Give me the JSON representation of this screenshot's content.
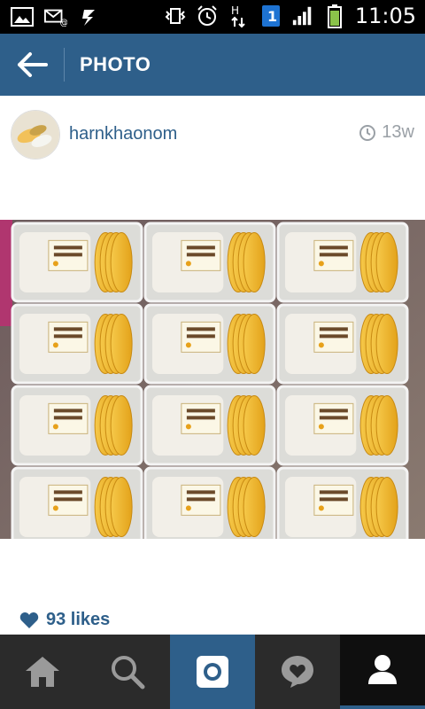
{
  "status_bar": {
    "time": "11:05",
    "notification_icons": [
      "gallery-icon",
      "messaging-icon",
      "usb-icon"
    ],
    "system_icons": [
      "vibrate-icon",
      "alarm-icon",
      "data-transfer-icon",
      "sim-badge-icon",
      "signal-icon",
      "battery-icon"
    ],
    "sim_label": "1",
    "data_label": "H"
  },
  "header": {
    "title": "PHOTO",
    "back_icon": "back-arrow-icon"
  },
  "post": {
    "username": "harnkhaonom",
    "age": "13w",
    "likes": "93 likes"
  },
  "bottom_nav": {
    "items": [
      "home-icon",
      "search-icon",
      "camera-icon",
      "activity-icon",
      "profile-icon"
    ],
    "active": "camera-icon",
    "current": "profile-icon"
  },
  "colors": {
    "brand": "#2e5f8a",
    "bar_dark": "#2b2b2b",
    "muted": "#9aa0a6",
    "mango": "#f2b632"
  }
}
